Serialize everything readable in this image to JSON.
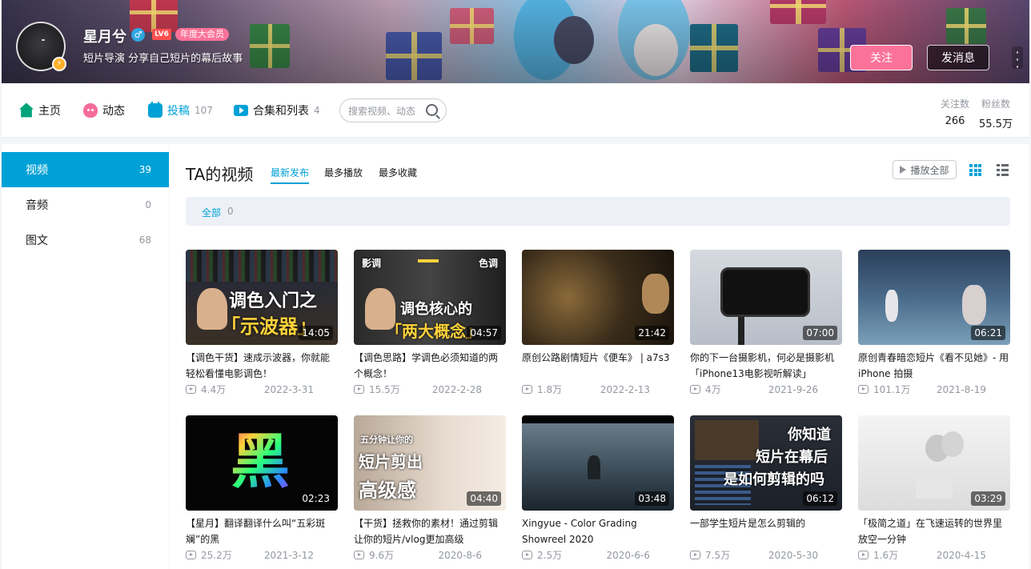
{
  "profile": {
    "name": "星月兮",
    "gender_symbol": "♂",
    "level": "LV6",
    "vip_label": "年度大会员",
    "signature": "短片导演 分享自己短片的幕后故事",
    "follow_label": "关注",
    "message_label": "发消息"
  },
  "nav": {
    "tabs": [
      {
        "label": "主页",
        "count": ""
      },
      {
        "label": "动态",
        "count": ""
      },
      {
        "label": "投稿",
        "count": "107"
      },
      {
        "label": "合集和列表",
        "count": "4"
      }
    ],
    "search_placeholder": "搜索视频、动态",
    "stats": {
      "following_label": "关注数",
      "following": "266",
      "fans_label": "粉丝数",
      "fans": "55.5万"
    }
  },
  "sidebar": {
    "items": [
      {
        "label": "视频",
        "count": "39"
      },
      {
        "label": "音频",
        "count": "0"
      },
      {
        "label": "图文",
        "count": "68"
      }
    ]
  },
  "videos": {
    "section_title": "TA的视频",
    "sort_options": [
      "最新发布",
      "最多播放",
      "最多收藏"
    ],
    "play_all": "播放全部",
    "filter_label": "全部",
    "filter_count": "0",
    "items": [
      {
        "title": "【调色干货】速成示波器，你就能轻松看懂电影调色！",
        "duration": "14:05",
        "plays": "4.4万",
        "date": "2022-3-31",
        "thumb_text": [
          "调色入门之",
          "「示波器」"
        ]
      },
      {
        "title": "【调色思路】学调色必须知道的两个概念！",
        "duration": "04:57",
        "plays": "15.5万",
        "date": "2022-2-28",
        "thumb_text": [
          "影调",
          "色调",
          "调色核心的",
          "「两大概念」"
        ]
      },
      {
        "title": "原创公路剧情短片《便车》 | a7s3",
        "duration": "21:42",
        "plays": "1.8万",
        "date": "2022-2-13",
        "thumb_text": []
      },
      {
        "title": "你的下一台摄影机，何必是摄影机「iPhone13电影视听解读」",
        "duration": "07:00",
        "plays": "4万",
        "date": "2021-9-26",
        "thumb_text": []
      },
      {
        "title": "原创青春暗恋短片《看不见她》- 用iPhone 拍摄",
        "duration": "06:21",
        "plays": "101.1万",
        "date": "2021-8-19",
        "thumb_text": []
      },
      {
        "title": "【星月】翻译翻译什么叫“五彩斑斓”的黑",
        "duration": "02:23",
        "plays": "25.2万",
        "date": "2021-3-12",
        "thumb_text": [
          "黑"
        ]
      },
      {
        "title": "【干货】拯救你的素材！通过剪辑让你的短片/vlog更加高级",
        "duration": "04:40",
        "plays": "9.6万",
        "date": "2020-8-6",
        "thumb_text": [
          "五分钟让你的",
          "短片剪出",
          "高级感"
        ]
      },
      {
        "title": "Xingyue - Color Grading Showreel 2020",
        "duration": "03:48",
        "plays": "2.5万",
        "date": "2020-6-6",
        "thumb_text": []
      },
      {
        "title": "一部学生短片是怎么剪辑的",
        "duration": "06:12",
        "plays": "7.5万",
        "date": "2020-5-30",
        "thumb_text": [
          "你知道",
          "短片在幕后",
          "是如何剪辑的吗"
        ]
      },
      {
        "title": "「极简之道」在飞速运转的世界里放空一分钟",
        "duration": "03:29",
        "plays": "1.6万",
        "date": "2020-4-15",
        "thumb_text": []
      }
    ]
  },
  "colors": {
    "accent": "#00a1d6",
    "pink": "#fb7299"
  }
}
